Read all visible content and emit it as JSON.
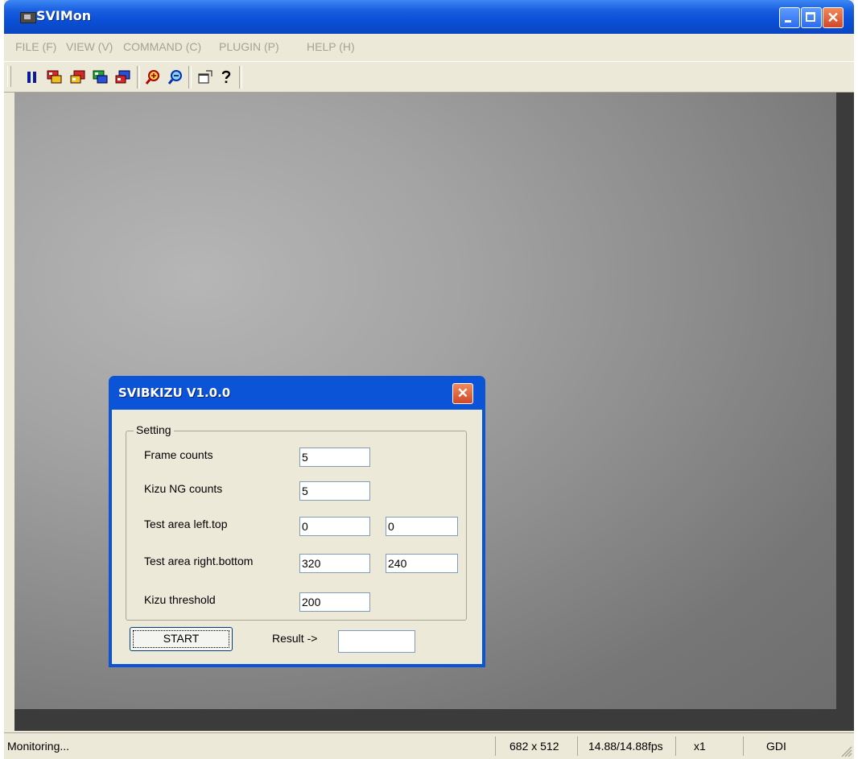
{
  "window": {
    "title": "SVIMon"
  },
  "menu": [
    "FILE (F)",
    "VIEW (V)",
    "COMMAND (C)",
    "PLUGIN (P)",
    "HELP (H)"
  ],
  "toolbar": {
    "icons": [
      "pause-icon",
      "capture-red-icon",
      "capture-red-alt-icon",
      "capture-green-icon",
      "capture-blue-icon",
      "zoom-in-icon",
      "zoom-out-icon",
      "properties-icon",
      "help-icon"
    ]
  },
  "status": {
    "message": "Monitoring...",
    "resolution": "682 x 512",
    "fps": "14.88/14.88fps",
    "zoom": "x1",
    "renderer": "GDI"
  },
  "dialog": {
    "title": "SVIBKIZU V1.0.0",
    "group_label": "Setting",
    "frame_counts": {
      "label": "Frame counts",
      "value": "5"
    },
    "kizu_ng_counts": {
      "label": "Kizu NG counts",
      "value": "5"
    },
    "left_top": {
      "label": "Test area left.top",
      "x": "0",
      "y": "0"
    },
    "right_bottom": {
      "label": "Test area right.bottom",
      "x": "320",
      "y": "240"
    },
    "threshold": {
      "label": "Kizu threshold",
      "value": "200"
    },
    "start_label": "START",
    "result_label": "Result ->",
    "result_value": ""
  },
  "colors": {
    "title_blue": "#0a4fd6",
    "close_red": "#d2472a",
    "face": "#ece9d8"
  }
}
